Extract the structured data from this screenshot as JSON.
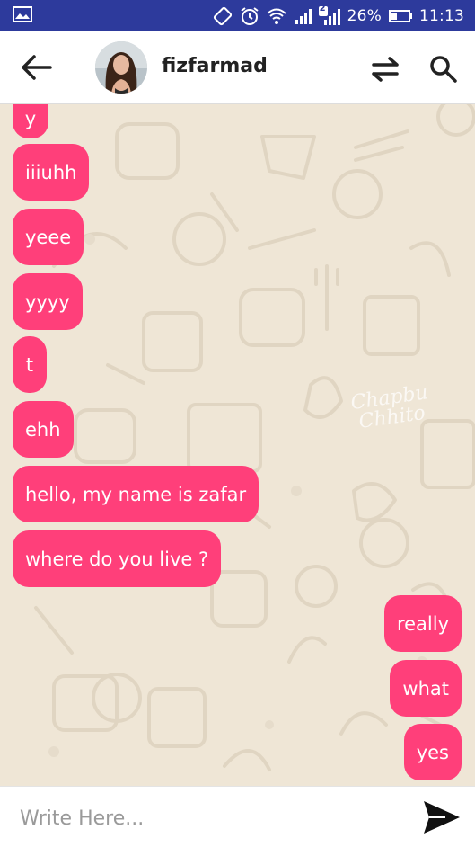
{
  "status_bar": {
    "sim_badge": "2",
    "battery": "26%",
    "time": "11:13"
  },
  "header": {
    "contact_name": "fizfarmad"
  },
  "chat": {
    "watermark_line1": "Chapbu",
    "watermark_line2": "Chhito",
    "messages": [
      {
        "text": "y",
        "side": "received"
      },
      {
        "text": "iiiuhh",
        "side": "received"
      },
      {
        "text": "yeee",
        "side": "received"
      },
      {
        "text": "yyyy",
        "side": "received"
      },
      {
        "text": "t",
        "side": "received"
      },
      {
        "text": "ehh",
        "side": "received"
      },
      {
        "text": "hello, my name is zafar",
        "side": "received"
      },
      {
        "text": "where do you live ?",
        "side": "received"
      },
      {
        "text": "really",
        "side": "sent"
      },
      {
        "text": "what",
        "side": "sent"
      },
      {
        "text": "yes",
        "side": "sent"
      }
    ]
  },
  "composer": {
    "placeholder": "Write Here..."
  },
  "colors": {
    "status_bar": "#2d3a9c",
    "bubble": "#ff3f7a",
    "chat_background": "#efe6d6"
  }
}
